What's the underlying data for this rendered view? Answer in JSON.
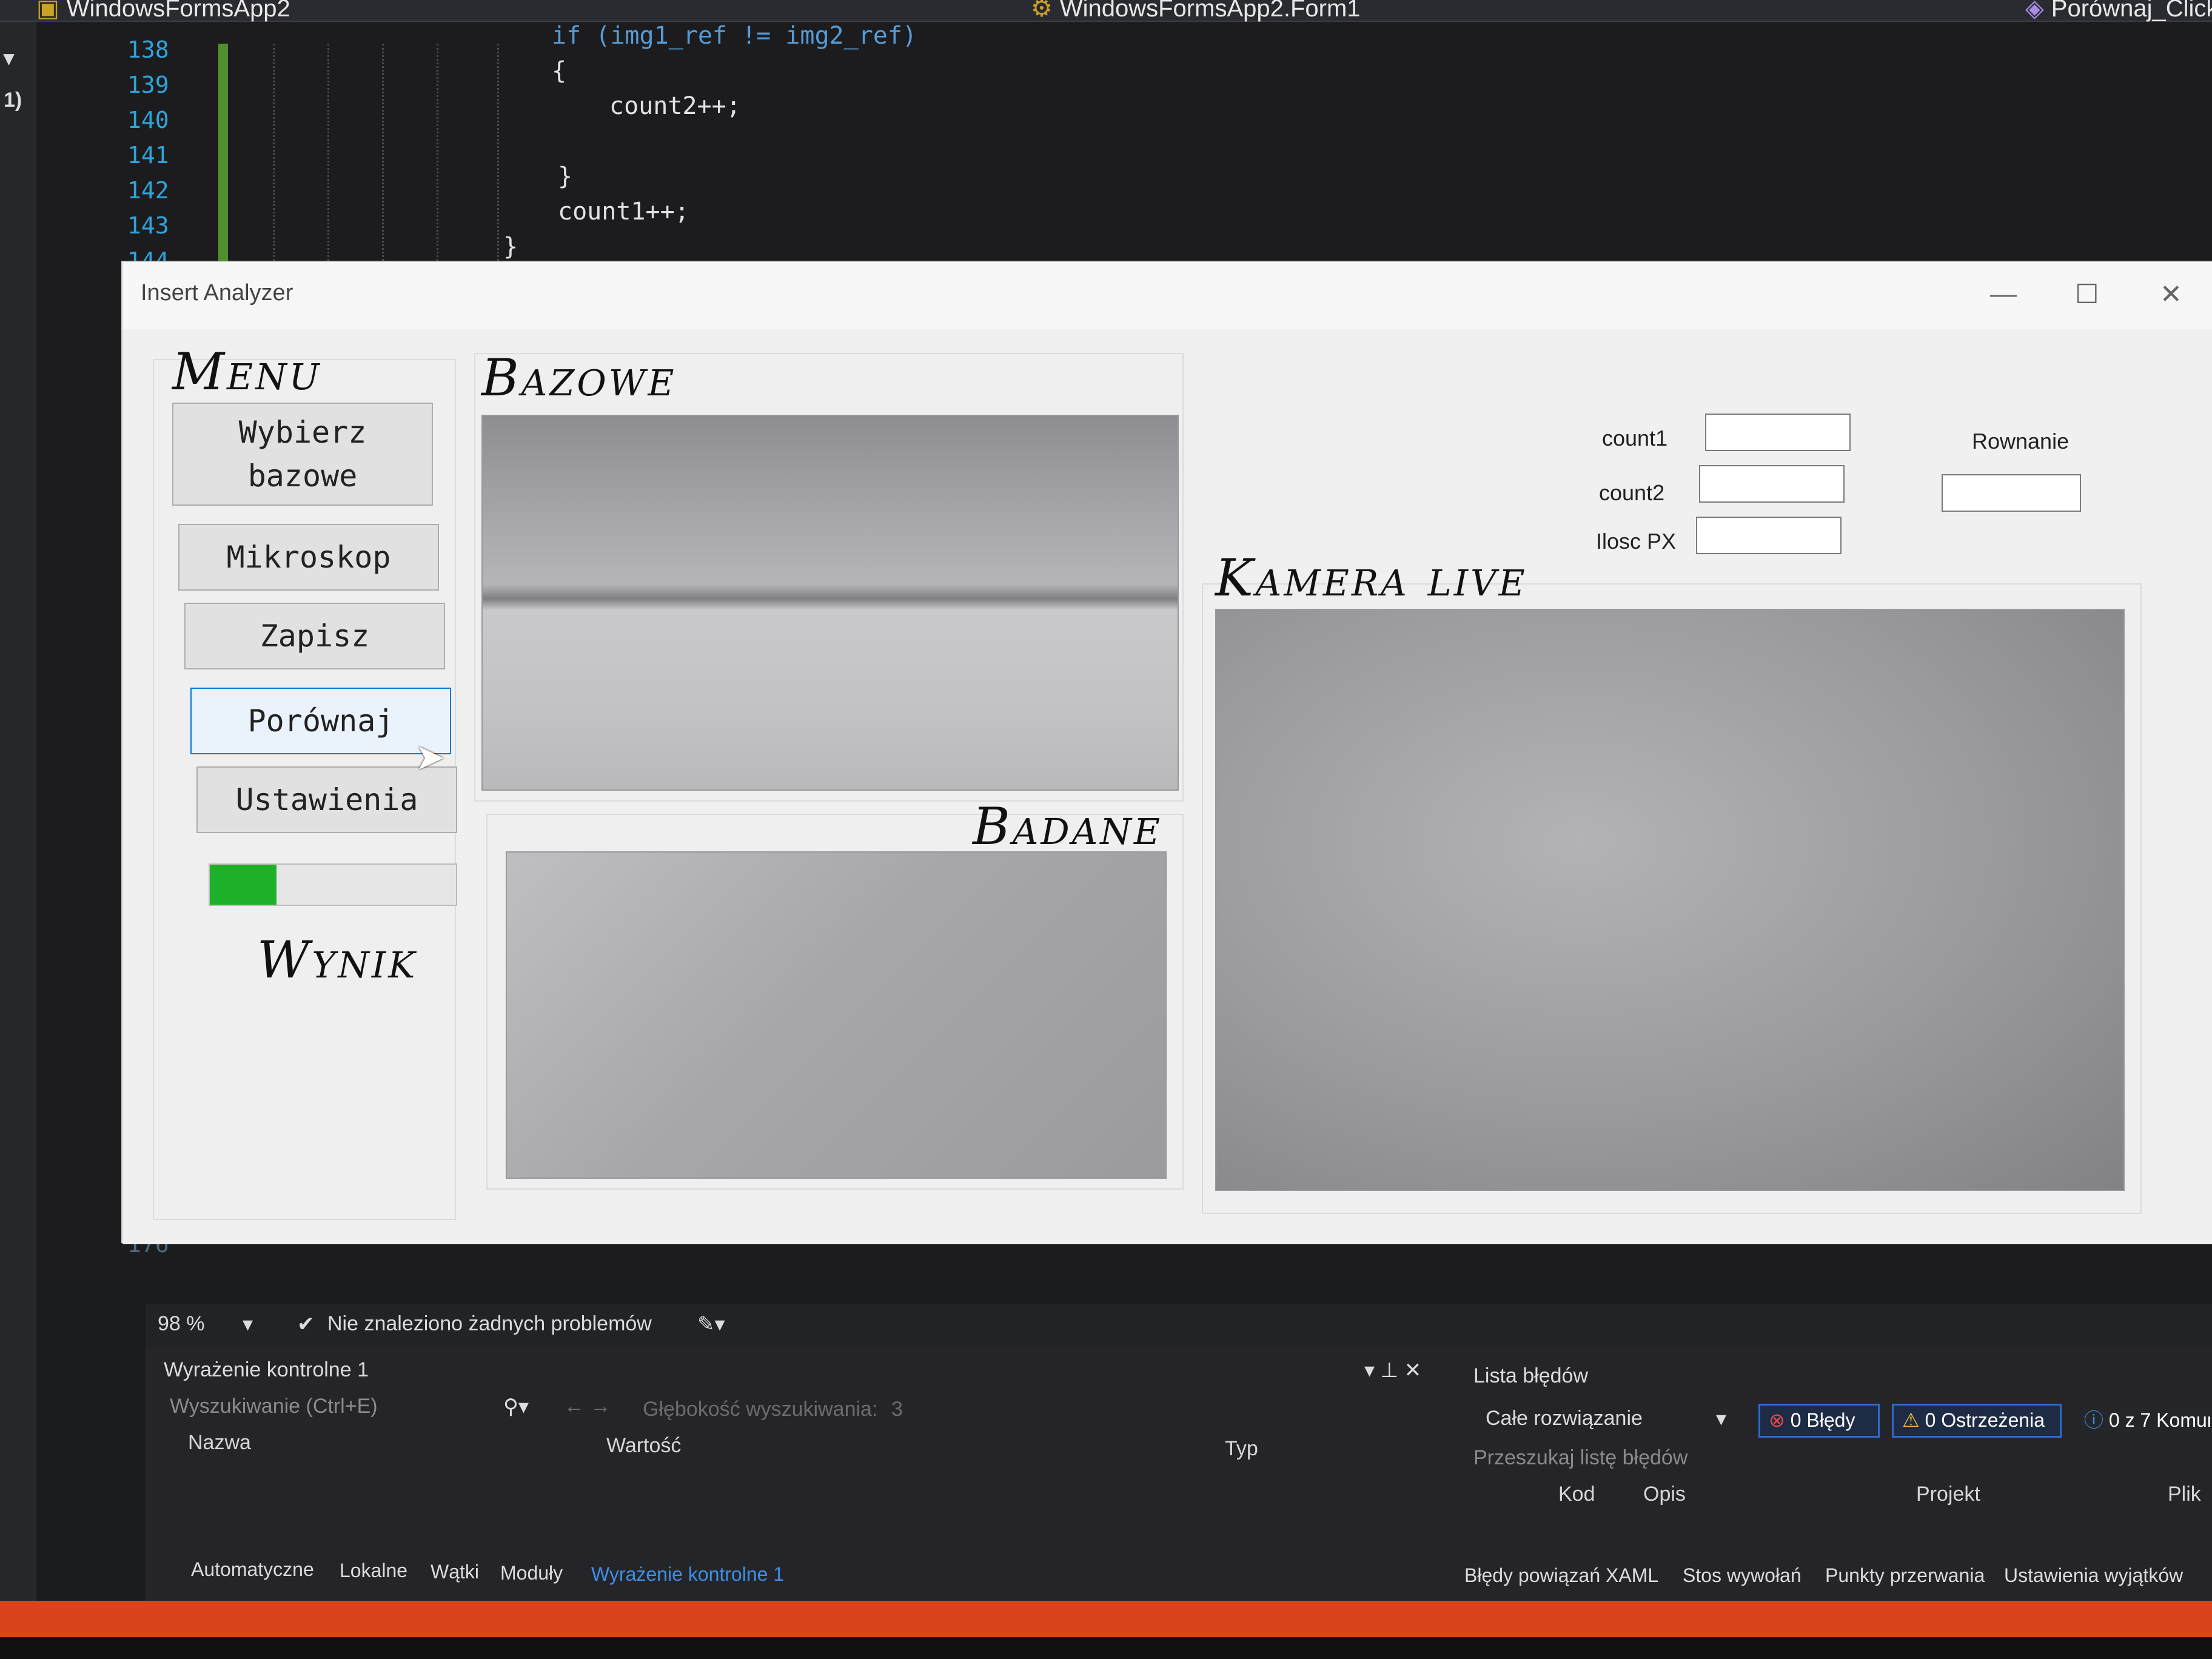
{
  "ide": {
    "left_tab": "WindowsFormsApp2",
    "middle_tab": "WindowsFormsApp2.Form1",
    "right_tab": "Porównaj_Click",
    "gutter_marks": [
      "▾",
      "1)"
    ],
    "line_numbers": [
      "138",
      "139",
      "140",
      "141",
      "142",
      "143",
      "144",
      "176"
    ],
    "code_lines": [
      "if (img1_ref != img2_ref)",
      "{",
      "count2++;",
      "}",
      "count1++;",
      "}",
      "[;}"
    ]
  },
  "form": {
    "title": "Insert Analyzer",
    "minimize": "—",
    "maximize": "☐",
    "close": "✕",
    "menu_title": "Menu",
    "buttons": [
      "Wybierz\nbazowe",
      "Mikroskop",
      "Zapisz",
      "Porównaj",
      "Ustawienia"
    ],
    "progress_percent": 27,
    "result_title": "Wynik",
    "base_title": "Bazowe",
    "test_title": "Badane",
    "live_title": "Kamera live",
    "fields": {
      "count1_label": "count1",
      "count2_label": "count2",
      "px_label": "Ilosc PX",
      "equation_label": "Rownanie"
    }
  },
  "status": {
    "zoom": "98 %",
    "zoom_arrow": "▾",
    "ok_icon": "✔",
    "problems": "Nie znaleziono żadnych problemów",
    "brush_icon": "✎▾"
  },
  "watch": {
    "title": "Wyrażenie kontrolne 1",
    "pin_controls": "▾ ⊥ ✕",
    "search_placeholder": "Wyszukiwanie (Ctrl+E)",
    "search_icon": "⚲▾",
    "nav_arrows": "← →",
    "depth_label": "Głębokość wyszukiwania:",
    "depth_value": "3",
    "columns": [
      "Nazwa",
      "Wartość",
      "Typ"
    ],
    "tabs": [
      "Automatyczne",
      "Lokalne",
      "Wątki",
      "Moduły",
      "Wyrażenie kontrolne 1"
    ]
  },
  "errors": {
    "title": "Lista błędów",
    "scope": "Całe rozwiązanie",
    "scope_arrow": "▾",
    "errors_badge": "0 Błędy",
    "warnings_badge": "0 Ostrzeżenia",
    "messages_badge": "0 z 7 Komunikaty",
    "search_placeholder": "Przeszukaj listę błędów",
    "columns": [
      "Kod",
      "Opis",
      "Projekt",
      "Plik"
    ],
    "tabs": [
      "Błędy powiązań XAML",
      "Stos wywołań",
      "Punkty przerwania",
      "Ustawienia wyjątków"
    ]
  },
  "colors": {
    "progress_fill": "#1fb02a",
    "accent_blue": "#2d6bcf",
    "orange_bar": "#d9441d"
  }
}
